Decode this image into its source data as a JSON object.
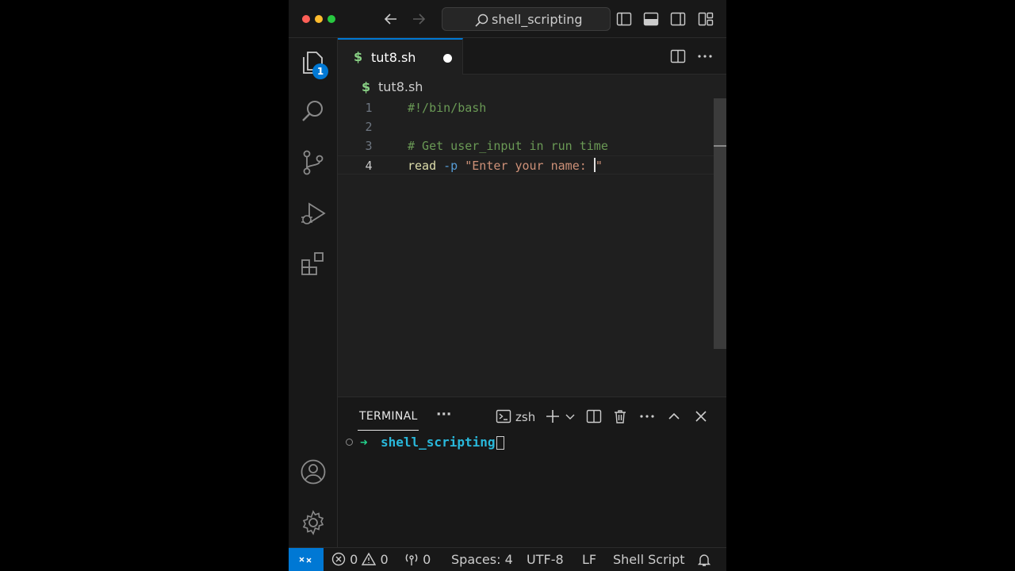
{
  "window": {
    "traffic_lights": [
      "#ff5f57",
      "#febc2e",
      "#28c840"
    ]
  },
  "titlebar": {
    "search_text": "shell_scripting",
    "icons": [
      "arrow-left-icon",
      "arrow-right-icon",
      "search-icon",
      "toggle-sidebar-icon",
      "toggle-panel-icon",
      "toggle-secondary-sidebar-icon",
      "customize-layout-icon"
    ]
  },
  "activity_bar": {
    "explorer_badge": "1",
    "icons": [
      "files-icon",
      "search-icon",
      "source-control-icon",
      "run-debug-icon",
      "extensions-icon",
      "account-icon",
      "gear-icon"
    ]
  },
  "editor": {
    "tab": {
      "label": "tut8.sh",
      "icon": "$",
      "modified": true
    },
    "breadcrumb": {
      "icon": "$",
      "label": "tut8.sh"
    },
    "lines": [
      {
        "num": "1",
        "tokens": [
          {
            "t": "#!/bin/bash",
            "c": "comment"
          }
        ]
      },
      {
        "num": "2",
        "tokens": []
      },
      {
        "num": "3",
        "tokens": [
          {
            "t": "# Get user_input in run time",
            "c": "comment"
          }
        ]
      },
      {
        "num": "4",
        "tokens": [
          {
            "t": "read",
            "c": "kw"
          },
          {
            "t": " ",
            "c": "plain"
          },
          {
            "t": "-p",
            "c": "flag"
          },
          {
            "t": " ",
            "c": "plain"
          },
          {
            "t": "\"Enter your name: ",
            "c": "str"
          },
          {
            "t": "|",
            "c": "cursor"
          },
          {
            "t": "\"",
            "c": "str"
          }
        ]
      }
    ],
    "active_line": "4"
  },
  "panel": {
    "title": "TERMINAL",
    "more": "···",
    "shell": "zsh",
    "prompt_arrow": "➜",
    "prompt_dir": "shell_scripting"
  },
  "statusbar": {
    "errors": "0",
    "warnings": "0",
    "ports": "0",
    "indent": "Spaces: 4",
    "encoding": "UTF-8",
    "eol": "LF",
    "language": "Shell Script"
  }
}
